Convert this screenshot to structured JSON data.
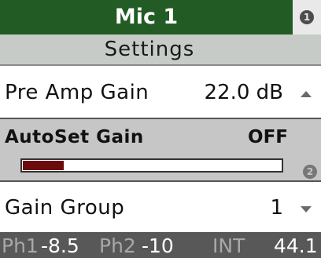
{
  "header": {
    "title": "Mic 1",
    "badge": "1"
  },
  "subheader": {
    "title": "Settings"
  },
  "rows": {
    "pre_amp": {
      "label": "Pre Amp Gain",
      "value": "22.0 dB",
      "arrow": "up-arrow-icon"
    },
    "autoset": {
      "label": "AutoSet Gain",
      "value": "OFF",
      "badge": "2",
      "meter_level": 0.16,
      "meter_color": "#6b0b0b"
    },
    "gain_group": {
      "label": "Gain Group",
      "value": "1",
      "arrow": "down-arrow-icon"
    }
  },
  "status": {
    "ph1_label": "Ph1",
    "ph1_value": "-8.5",
    "ph2_label": "Ph2",
    "ph2_value": "-10",
    "int_label": "INT",
    "rate": "44.1"
  },
  "colors": {
    "title_bg": "#235b25",
    "subheader_bg": "#c7cbc7",
    "selected_row_bg": "#c6c6c6",
    "status_bg": "#585858"
  }
}
